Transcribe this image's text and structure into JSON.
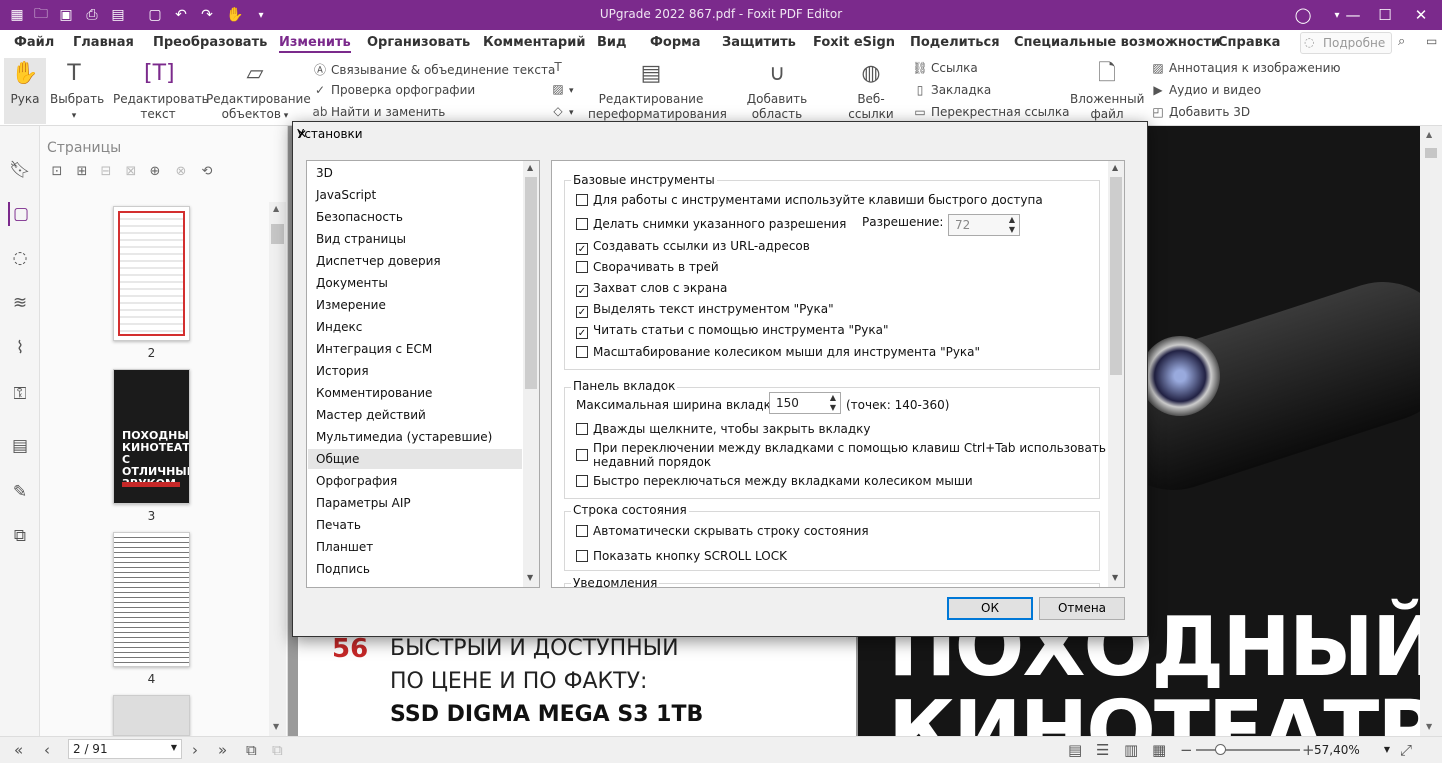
{
  "window": {
    "title": "UPgrade 2022 867.pdf - Foxit PDF Editor"
  },
  "menu": {
    "items": [
      "Файл",
      "Главная",
      "Преобразовать",
      "Изменить",
      "Организовать",
      "Комментарий",
      "Вид",
      "Форма",
      "Защитить",
      "Foxit eSign",
      "Поделиться",
      "Специальные возможности",
      "Справка"
    ],
    "active_index": 3,
    "search_placeholder": "Подробне"
  },
  "ribbon": {
    "hand": "Рука",
    "select": "Выбрать",
    "edit_text": "Редактировать текст",
    "edit_objects": "Редактирование объектов",
    "link_join": "Связывание & объединение текста",
    "spellcheck": "Проверка орфографии",
    "find_replace": "Найти и заменить",
    "reflow": "Редактирование переформатирования",
    "add_article": "Добавить область статьи",
    "weblinks": "Веб-ссылки",
    "link": "Ссылка",
    "bookmark": "Закладка",
    "crossref": "Перекрестная ссылка",
    "attachment": "Вложенный файл",
    "img_annot": "Аннотация к изображению",
    "audio_video": "Аудио и видео",
    "add3d": "Добавить 3D"
  },
  "pages_panel": {
    "title": "Страницы",
    "thumbs": [
      "2",
      "3",
      "4"
    ]
  },
  "dialog": {
    "title": "Установки",
    "categories": [
      "3D",
      "JavaScript",
      "Безопасность",
      "Вид страницы",
      "Диспетчер доверия",
      "Документы",
      "Измерение",
      "Индекс",
      "Интеграция с ECM",
      "История",
      "Комментирование",
      "Мастер действий",
      "Мультимедиа (устаревшие)",
      "Общие",
      "Орфография",
      "Параметры AIP",
      "Печать",
      "Планшет",
      "Подпись"
    ],
    "selected_category": "Общие",
    "basic": {
      "title": "Базовые инструменты",
      "opt1": "Для работы с инструментами используйте клавиши быстрого доступа",
      "opt2": "Делать снимки указанного разрешения",
      "resolution_label": "Разрешение:",
      "resolution_value": "72",
      "opt3": "Создавать ссылки из URL-адресов",
      "opt4": "Сворачивать в трей",
      "opt5": "Захват слов с экрана",
      "opt6": "Выделять текст инструментом \"Рука\"",
      "opt7": "Читать статьи с помощью инструмента \"Рука\"",
      "opt8": "Масштабирование колесиком мыши для инструмента \"Рука\"",
      "checked": [
        false,
        false,
        true,
        false,
        true,
        true,
        true,
        false
      ]
    },
    "tabs": {
      "title": "Панель вкладок",
      "max_width_label": "Максимальная ширина вкладки:",
      "max_width_value": "150",
      "range": "(точек: 140-360)",
      "opt1": "Дважды щелкните, чтобы закрыть вкладку",
      "opt2a": "При переключении между вкладками с помощью клавиш Ctrl+Tab использовать",
      "opt2b": "недавний порядок",
      "opt3": "Быстро переключаться между вкладками колесиком мыши"
    },
    "status": {
      "title": "Строка состояния",
      "opt1": "Автоматически скрывать строку состояния",
      "opt2": "Показать кнопку SCROLL LOCK"
    },
    "notifications": {
      "title": "Уведомления"
    },
    "ok": "ОК",
    "cancel": "Отмена"
  },
  "document": {
    "toc_number": "56",
    "toc_line1": "БЫСТРЫЙ И ДОСТУПНЫЙ",
    "toc_line2": "ПО ЦЕНЕ И ПО ФАКТУ:",
    "toc_line3": "SSD DIGMA MEGA S3 1TB",
    "cover_line1": "ПОХОДНЫЙ",
    "cover_line2": "КИНОТЕАТР"
  },
  "statusbar": {
    "page_value": "2 / 91",
    "zoom": "57,40%"
  },
  "colors": {
    "accent": "#7b2a8c",
    "toc_red": "#c62828"
  }
}
